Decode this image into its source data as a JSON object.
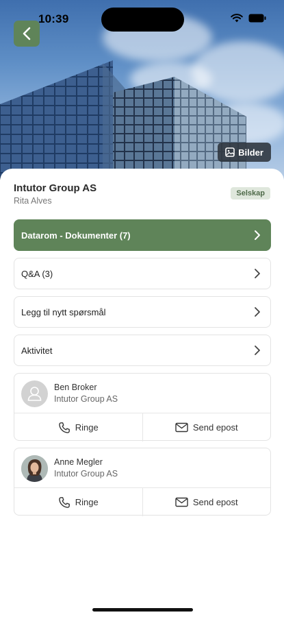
{
  "status_bar": {
    "time": "10:39"
  },
  "hero": {
    "gallery_label": "Bilder"
  },
  "header": {
    "company": "Intutor Group AS",
    "contact": "Rita Alves",
    "badge": "Selskap"
  },
  "menu": [
    {
      "label": "Datarom - Dokumenter (7)"
    },
    {
      "label": "Q&A (3)"
    },
    {
      "label": "Legg til nytt spørsmål"
    },
    {
      "label": "Aktivitet"
    }
  ],
  "people": [
    {
      "name": "Ben Broker",
      "company": "Intutor Group AS",
      "call_label": "Ringe",
      "email_label": "Send epost"
    },
    {
      "name": "Anne Megler",
      "company": "Intutor Group AS",
      "call_label": "Ringe",
      "email_label": "Send epost"
    }
  ],
  "colors": {
    "accent": "#5f8459",
    "badge_bg": "#dfe7dc",
    "badge_text": "#4f6b4a"
  }
}
